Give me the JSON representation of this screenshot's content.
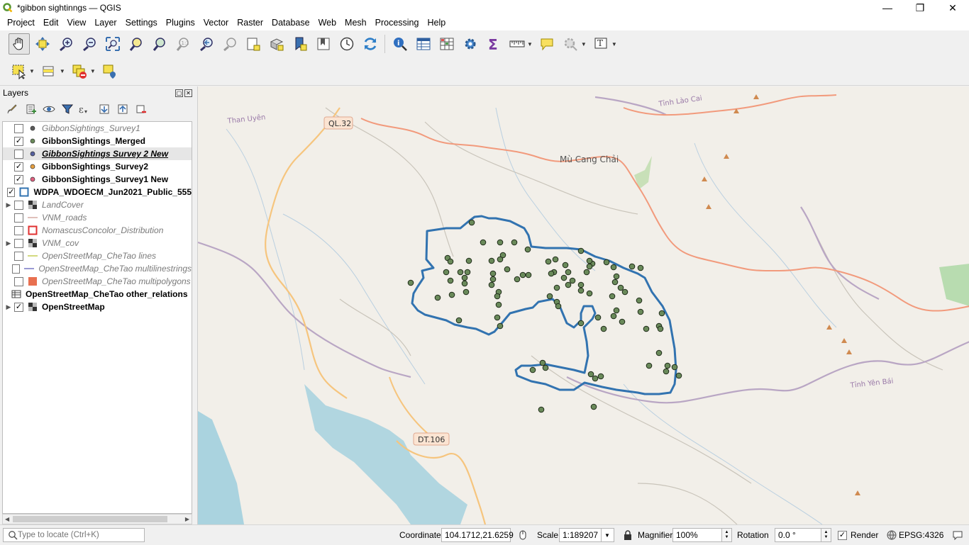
{
  "window": {
    "title": "*gibbon sightinngs — QGIS",
    "min": "—",
    "max": "❐",
    "close": "✕"
  },
  "menu": [
    "Project",
    "Edit",
    "View",
    "Layer",
    "Settings",
    "Plugins",
    "Vector",
    "Raster",
    "Database",
    "Web",
    "Mesh",
    "Processing",
    "Help"
  ],
  "layers_panel": {
    "title": "Layers",
    "layers": [
      {
        "name": "GibbonSightings_Survey1",
        "checked": false,
        "state": "off",
        "symbol": "point",
        "color": "#5a5a5a",
        "expand": false
      },
      {
        "name": "GibbonSightings_Merged",
        "checked": true,
        "state": "on",
        "symbol": "point",
        "color": "#6a8a5a",
        "expand": false
      },
      {
        "name": "GibbonSightings Survey 2 New",
        "checked": false,
        "state": "off-under",
        "symbol": "point",
        "color": "#5560a0",
        "expand": false
      },
      {
        "name": "GibbonSightings_Survey2",
        "checked": true,
        "state": "on",
        "symbol": "point",
        "color": "#e8a040",
        "expand": false
      },
      {
        "name": "GibbonSightings_Survey1 New",
        "checked": true,
        "state": "on",
        "symbol": "point",
        "color": "#e06080",
        "expand": false
      },
      {
        "name": "WDPA_WDOECM_Jun2021_Public_555",
        "checked": true,
        "state": "on",
        "symbol": "polygon-outline",
        "color": "#3273b0",
        "expand": false
      },
      {
        "name": "LandCover",
        "checked": false,
        "state": "off",
        "symbol": "raster",
        "color": "#333333",
        "expand": true
      },
      {
        "name": "VNM_roads",
        "checked": false,
        "state": "off",
        "symbol": "line",
        "color": "#d8b0a8",
        "expand": false
      },
      {
        "name": "NomascusConcolor_Distribution",
        "checked": false,
        "state": "off",
        "symbol": "polygon-outline",
        "color": "#e03030",
        "expand": false
      },
      {
        "name": "VNM_cov",
        "checked": false,
        "state": "off",
        "symbol": "raster",
        "color": "#333333",
        "expand": true
      },
      {
        "name": "OpenStreetMap_CheTao lines",
        "checked": false,
        "state": "off",
        "symbol": "line",
        "color": "#c8d060",
        "expand": false
      },
      {
        "name": "OpenStreetMap_CheTao multilinestrings",
        "checked": false,
        "state": "off",
        "symbol": "line",
        "color": "#8080c8",
        "expand": false
      },
      {
        "name": "OpenStreetMap_CheTao multipolygons",
        "checked": false,
        "state": "off",
        "symbol": "polygon-fill",
        "color": "#e87050",
        "expand": false
      },
      {
        "name": "OpenStreetMap_CheTao other_relations",
        "checked": null,
        "state": "on",
        "symbol": "table",
        "color": "#333333",
        "expand": false
      },
      {
        "name": "OpenStreetMap",
        "checked": true,
        "state": "on",
        "symbol": "raster",
        "color": "#333333",
        "expand": true
      }
    ]
  },
  "map": {
    "labels": {
      "tinh_lao_cai": "Tỉnh Lào Cai",
      "than_uyen": "Than Uyên",
      "ql32": "QL.32",
      "mu_cang_chai": "Mù Cang Chải",
      "dt106": "DT.106",
      "tinh_yen_bai": "Tỉnh Yên Bái"
    }
  },
  "status": {
    "locate_placeholder": "Type to locate (Ctrl+K)",
    "coordinate_label": "Coordinate",
    "coordinate": "104.1712,21.6259",
    "scale_label": "Scale",
    "scale": "1:189207",
    "magnifier_label": "Magnifier",
    "magnifier": "100%",
    "rotation_label": "Rotation",
    "rotation": "0.0 °",
    "render_label": "Render",
    "crs": "EPSG:4326"
  }
}
